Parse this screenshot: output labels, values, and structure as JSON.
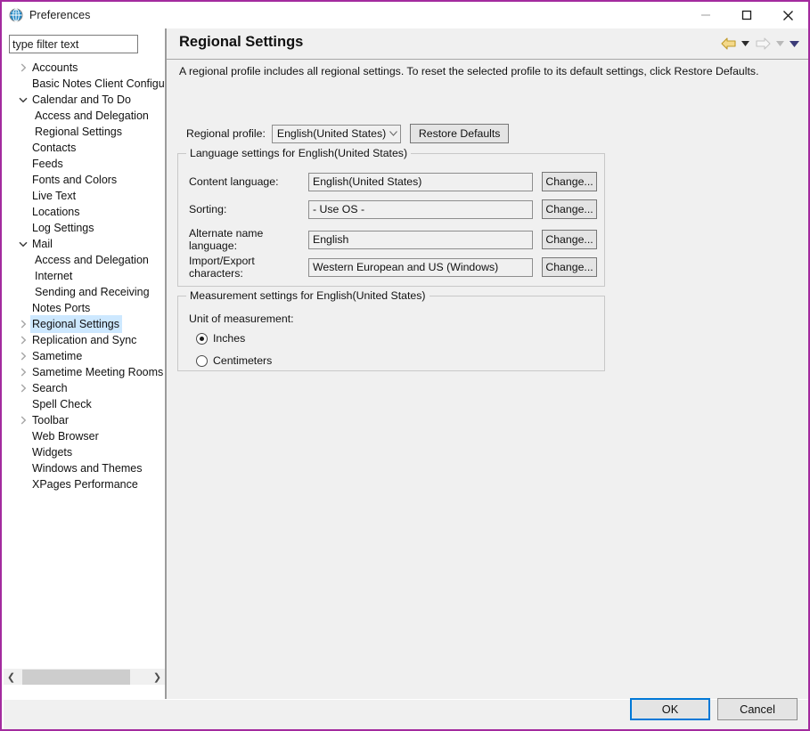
{
  "window": {
    "title": "Preferences",
    "icon": "preferences-globe-icon",
    "border_color": "#a32a9e",
    "minimize_label": "Minimize",
    "maximize_label": "Maximize",
    "close_label": "Close"
  },
  "sidebar": {
    "filter": {
      "value": "type filter text",
      "placeholder": "type filter text"
    },
    "items": [
      {
        "label": "Accounts",
        "level": 0,
        "arrow": "collapsed",
        "selected": false
      },
      {
        "label": "Basic Notes Client Configura",
        "level": 0,
        "arrow": "none",
        "selected": false
      },
      {
        "label": "Calendar and To Do",
        "level": 0,
        "arrow": "expanded",
        "selected": false
      },
      {
        "label": "Access and Delegation",
        "level": 1,
        "arrow": "none",
        "selected": false
      },
      {
        "label": "Regional Settings",
        "level": 1,
        "arrow": "none",
        "selected": false
      },
      {
        "label": "Contacts",
        "level": 0,
        "arrow": "none",
        "selected": false
      },
      {
        "label": "Feeds",
        "level": 0,
        "arrow": "none",
        "selected": false
      },
      {
        "label": "Fonts and Colors",
        "level": 0,
        "arrow": "none",
        "selected": false
      },
      {
        "label": "Live Text",
        "level": 0,
        "arrow": "none",
        "selected": false
      },
      {
        "label": "Locations",
        "level": 0,
        "arrow": "none",
        "selected": false
      },
      {
        "label": "Log Settings",
        "level": 0,
        "arrow": "none",
        "selected": false
      },
      {
        "label": "Mail",
        "level": 0,
        "arrow": "expanded",
        "selected": false
      },
      {
        "label": "Access and Delegation",
        "level": 1,
        "arrow": "none",
        "selected": false
      },
      {
        "label": "Internet",
        "level": 1,
        "arrow": "none",
        "selected": false
      },
      {
        "label": "Sending and Receiving",
        "level": 1,
        "arrow": "none",
        "selected": false
      },
      {
        "label": "Notes Ports",
        "level": 0,
        "arrow": "none",
        "selected": false
      },
      {
        "label": "Regional Settings",
        "level": 0,
        "arrow": "collapsed",
        "selected": true
      },
      {
        "label": "Replication and Sync",
        "level": 0,
        "arrow": "collapsed",
        "selected": false
      },
      {
        "label": "Sametime",
        "level": 0,
        "arrow": "collapsed",
        "selected": false
      },
      {
        "label": "Sametime Meeting Rooms",
        "level": 0,
        "arrow": "collapsed",
        "selected": false
      },
      {
        "label": "Search",
        "level": 0,
        "arrow": "collapsed",
        "selected": false
      },
      {
        "label": "Spell Check",
        "level": 0,
        "arrow": "none",
        "selected": false
      },
      {
        "label": "Toolbar",
        "level": 0,
        "arrow": "collapsed",
        "selected": false
      },
      {
        "label": "Web Browser",
        "level": 0,
        "arrow": "none",
        "selected": false
      },
      {
        "label": "Widgets",
        "level": 0,
        "arrow": "none",
        "selected": false
      },
      {
        "label": "Windows and Themes",
        "level": 0,
        "arrow": "none",
        "selected": false
      },
      {
        "label": "XPages Performance",
        "level": 0,
        "arrow": "none",
        "selected": false
      }
    ],
    "hscroll": {
      "left_arrow": "❮",
      "right_arrow": "❯"
    }
  },
  "page": {
    "title": "Regional Settings",
    "intro": "A regional profile includes all regional settings.  To reset the selected profile to its default settings, click Restore Defaults.",
    "nav": {
      "back_icon": "back-arrow-icon",
      "back_menu_icon": "caret-down-icon",
      "forward_icon": "forward-arrow-icon",
      "forward_menu_icon": "caret-down-icon",
      "overflow_icon": "caret-down-icon",
      "back_color": "#e8b33a",
      "forward_color": "#d6d6d6",
      "overflow_color": "#3b3b78"
    },
    "profile": {
      "label": "Regional profile:",
      "value": "English(United States)",
      "restore_button": "Restore Defaults"
    },
    "language_group": {
      "legend": "Language settings for English(United States)",
      "rows": [
        {
          "label": "Content language:",
          "value": "English(United States)",
          "button": "Change..."
        },
        {
          "label": "Sorting:",
          "value": "- Use OS -",
          "button": "Change..."
        },
        {
          "label": "Alternate name language:",
          "value": "English",
          "button": "Change..."
        },
        {
          "label": "Import/Export characters:",
          "value": "Western European and US (Windows)",
          "button": "Change..."
        }
      ]
    },
    "measurement_group": {
      "legend": "Measurement settings for English(United States)",
      "unit_label": "Unit of measurement:",
      "options": [
        {
          "label": "Inches",
          "checked": true
        },
        {
          "label": "Centimeters",
          "checked": false
        }
      ]
    }
  },
  "footer": {
    "ok_label": "OK",
    "cancel_label": "Cancel",
    "ok_accent": "#0078d7"
  }
}
